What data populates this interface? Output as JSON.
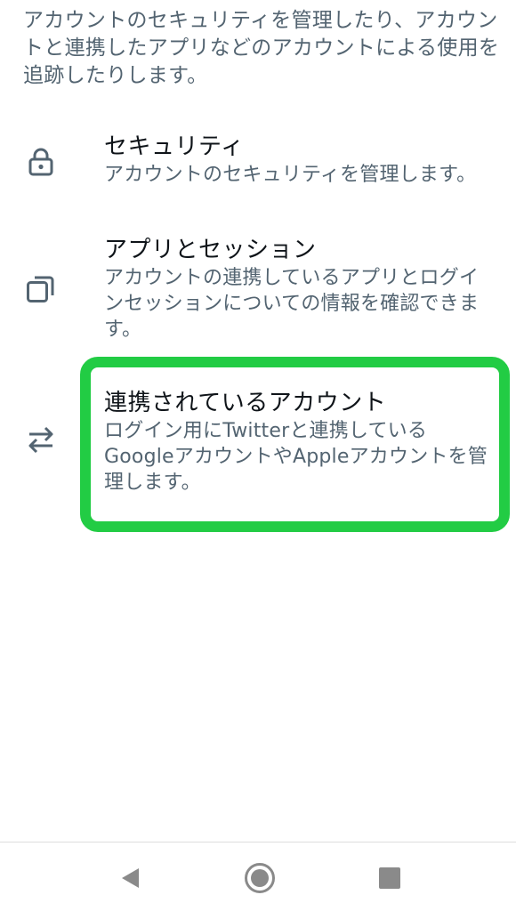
{
  "intro": {
    "text": "アカウントのセキュリティを管理したり、アカウントと連携したアプリなどのアカウントによる使用を追跡したりします。"
  },
  "items": [
    {
      "icon": "lock-icon",
      "title": "セキュリティ",
      "description": "アカウントのセキュリティを管理します。"
    },
    {
      "icon": "apps-sessions-icon",
      "title": "アプリとセッション",
      "description": "アカウントの連携しているアプリとログインセッションについての情報を確認できます。"
    },
    {
      "icon": "swap-arrows-icon",
      "title": "連携されているアカウント",
      "description": "ログイン用にTwitterと連携しているGoogleアカウントやAppleアカウントを管理します。"
    }
  ],
  "highlight": {
    "color": "#22cc44",
    "target": "連携されているアカウント"
  },
  "navbar": {
    "buttons": [
      "back-icon",
      "home-icon",
      "recents-icon"
    ],
    "color": "#8a8a8a"
  },
  "colors": {
    "title": "#0f1419",
    "secondary": "#536471",
    "icon": "#536471"
  }
}
